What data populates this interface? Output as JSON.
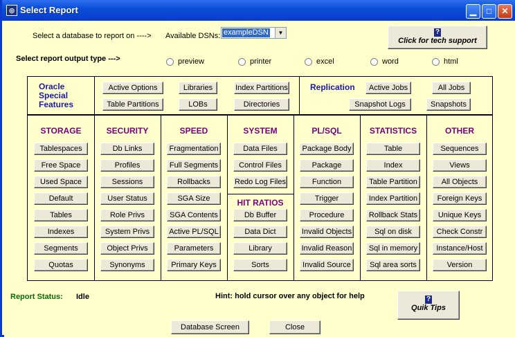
{
  "window": {
    "title": "Select Report",
    "icon": "app-icon"
  },
  "database": {
    "prompt": "Select a database to report on ---->",
    "dsn_label": "Available DSNs:",
    "dsn_value": "exampleDSN"
  },
  "tech_support": {
    "label": "Click for tech support"
  },
  "output": {
    "prompt": "Select report output type --->",
    "options": [
      "preview",
      "printer",
      "excel",
      "word",
      "html"
    ]
  },
  "oracle": {
    "label_lines": [
      "Oracle",
      "Special",
      "Features"
    ],
    "buttons": [
      "Active Options",
      "Libraries",
      "Index Partitions",
      "Table Partitions",
      "LOBs",
      "Directories"
    ]
  },
  "replication": {
    "label": "Replication",
    "buttons": [
      "Active Jobs",
      "All Jobs",
      "Snapshot Logs",
      "Snapshots"
    ]
  },
  "columns": [
    {
      "header": "STORAGE",
      "buttons": [
        "Tablespaces",
        "Free Space",
        "Used Space",
        "Default",
        "Tables",
        "Indexes",
        "Segments",
        "Quotas"
      ]
    },
    {
      "header": "SECURITY",
      "buttons": [
        "Db Links",
        "Profiles",
        "Sessions",
        "User Status",
        "Role Privs",
        "System Privs",
        "Object Privs",
        "Synonyms"
      ]
    },
    {
      "header": "SPEED",
      "buttons": [
        "Fragmentation",
        "Full Segments",
        "Rollbacks",
        "SGA Size",
        "SGA Contents",
        "Active PL/SQL",
        "Parameters",
        "Primary Keys"
      ]
    },
    {
      "header": "SYSTEM",
      "buttons": [
        "Data Files",
        "Control Files",
        "Redo Log Files"
      ]
    },
    {
      "header": "PL/SQL",
      "buttons": [
        "Package Body",
        "Package",
        "Function",
        "Trigger",
        "Procedure",
        "Invalid Objects",
        "Invalid Reason",
        "Invalid Source"
      ]
    },
    {
      "header": "STATISTICS",
      "buttons": [
        "Table",
        "Index",
        "Table Partition",
        "Index Partition",
        "Rollback Stats",
        "Sql on disk",
        "Sql in memory",
        "Sql area sorts"
      ]
    },
    {
      "header": "OTHER",
      "buttons": [
        "Sequences",
        "Views",
        "All Objects",
        "Foreign Keys",
        "Unique Keys",
        "Check Constr",
        "Instance/Host",
        "Version"
      ]
    }
  ],
  "hit_ratios": {
    "header": "HIT RATIOS",
    "buttons": [
      "Db Buffer",
      "Data Dict",
      "Library",
      "Sorts"
    ]
  },
  "status": {
    "label": "Report Status:",
    "value": "Idle",
    "hint": "Hint: hold cursor over any object for help"
  },
  "quik_tips": {
    "label": "Quik Tips"
  },
  "footer": {
    "database_screen": "Database Screen",
    "close": "Close"
  }
}
